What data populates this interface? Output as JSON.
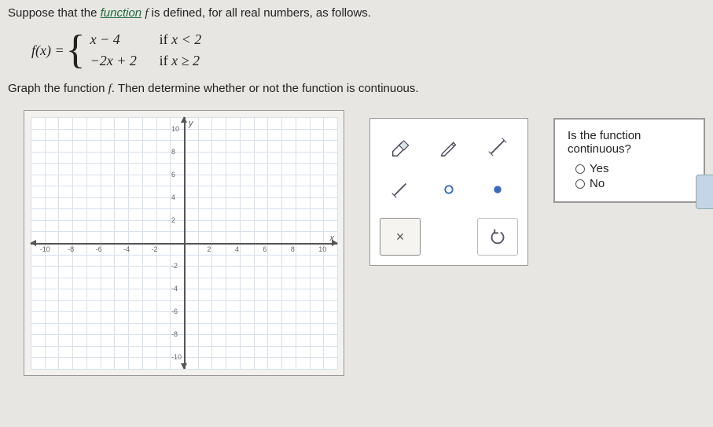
{
  "intro_pre": "Suppose that the ",
  "intro_link": "function",
  "intro_post": " f is defined, for all real numbers, as follows.",
  "fn_lhs": "f(x) =",
  "piece1_expr": "x − 4",
  "piece1_cond_pre": "if ",
  "piece1_cond": "x < 2",
  "piece2_expr": "−2x + 2",
  "piece2_cond_pre": "if ",
  "piece2_cond": "x ≥ 2",
  "instr2_pre": "Graph the function ",
  "instr2_f": "f",
  "instr2_post": ". Then determine whether or not the function is continuous.",
  "axis_ticks_x": [
    "-10",
    "-8",
    "-6",
    "-4",
    "-2",
    "2",
    "4",
    "6",
    "8",
    "10"
  ],
  "axis_ticks_y": [
    "10",
    "8",
    "6",
    "4",
    "2",
    "-2",
    "-4",
    "-6",
    "-8",
    "-10"
  ],
  "y_axis_label": "y",
  "x_axis_label": "x",
  "question": "Is the function continuous?",
  "opt_yes": "Yes",
  "opt_no": "No",
  "tool_clear": "×",
  "chart_data": {
    "type": "line",
    "title": "",
    "xlabel": "x",
    "ylabel": "y",
    "xlim": [
      -10,
      10
    ],
    "ylim": [
      -10,
      10
    ],
    "series": []
  }
}
